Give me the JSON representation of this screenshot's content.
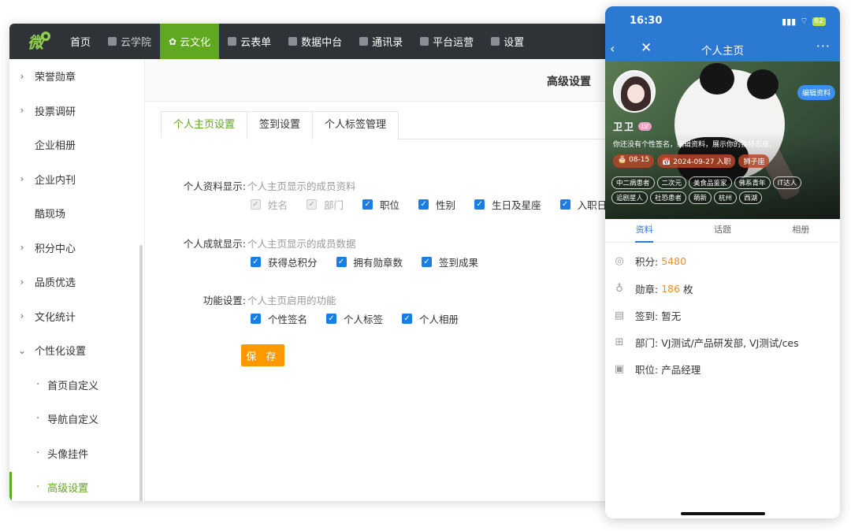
{
  "topnav": {
    "logo_text": "微",
    "items": [
      {
        "label": "首页",
        "icon": "none"
      },
      {
        "label": "云学院",
        "icon": "book-icon"
      },
      {
        "label": "云文化",
        "icon": "gear-flower-icon",
        "active": true
      },
      {
        "label": "云表单",
        "icon": "form-icon"
      },
      {
        "label": "数据中台",
        "icon": "cube-icon"
      },
      {
        "label": "通讯录",
        "icon": "contact-icon"
      },
      {
        "label": "平台运营",
        "icon": "grid-icon"
      },
      {
        "label": "设置",
        "icon": "grid-icon"
      }
    ],
    "active_color": "#5fa81f"
  },
  "sidebar": {
    "items": [
      {
        "label": "荣誉勋章",
        "arrow": "›"
      },
      {
        "label": "投票调研",
        "arrow": "›"
      },
      {
        "label": "企业相册",
        "arrow": ""
      },
      {
        "label": "企业内刊",
        "arrow": "›"
      },
      {
        "label": "酷现场",
        "arrow": ""
      },
      {
        "label": "积分中心",
        "arrow": "›"
      },
      {
        "label": "品质优选",
        "arrow": "›"
      },
      {
        "label": "文化统计",
        "arrow": "›"
      },
      {
        "label": "个性化设置",
        "arrow": "⌄"
      }
    ],
    "subitems": [
      {
        "label": "首页自定义",
        "bullet": "·"
      },
      {
        "label": "导航自定义",
        "bullet": "·"
      },
      {
        "label": "头像挂件",
        "bullet": "·"
      },
      {
        "label": "高级设置",
        "bullet": "·",
        "active": true
      }
    ]
  },
  "content": {
    "title": "高级设置",
    "tabs": [
      "个人主页设置",
      "签到设置",
      "个人标签管理"
    ],
    "profile_display": {
      "label": "个人资料显示:",
      "hint": "个人主页显示的成员资料",
      "options": [
        {
          "label": "姓名",
          "checked": true,
          "disabled": true
        },
        {
          "label": "部门",
          "checked": true,
          "disabled": true
        },
        {
          "label": "职位",
          "checked": true,
          "disabled": false
        },
        {
          "label": "性别",
          "checked": true,
          "disabled": false
        },
        {
          "label": "生日及星座",
          "checked": true,
          "disabled": false
        },
        {
          "label": "入职日期",
          "checked": true,
          "disabled": false
        }
      ]
    },
    "achievement_display": {
      "label": "个人成就显示:",
      "hint": "个人主页显示的成员数据",
      "options": [
        {
          "label": "获得总积分",
          "checked": true
        },
        {
          "label": "拥有勋章数",
          "checked": true
        },
        {
          "label": "签到成果",
          "checked": true
        }
      ]
    },
    "function_settings": {
      "label": "功能设置:",
      "hint": "个人主页启用的功能",
      "options": [
        {
          "label": "个性签名",
          "checked": true
        },
        {
          "label": "个人标签",
          "checked": true
        },
        {
          "label": "个人相册",
          "checked": true
        }
      ]
    },
    "save_label": "保 存",
    "check_mark": "✓"
  },
  "phone": {
    "status": {
      "time": "16:30",
      "signal": "📶",
      "wifi": "⌔",
      "battery": "62"
    },
    "nav": {
      "back": "‹",
      "close": "✕",
      "title": "个人主页",
      "more": "···"
    },
    "edit_label": "编辑资料",
    "user_name": "卫卫",
    "level_badge": "LV",
    "bio": "你还没有个性签名，编辑资料，展示你的独特态度。",
    "meta": [
      "🎂 08-15",
      "📅 2024-09-27 入职",
      "狮子座"
    ],
    "tags": [
      "中二病患者",
      "二次元",
      "美食品鉴家",
      "佛系青年",
      "IT达人",
      "追剧星人",
      "社恐患者",
      "萌新",
      "杭州",
      "西湖"
    ],
    "tabs": [
      "资料",
      "话题",
      "相册"
    ],
    "info": [
      {
        "icon": "points-icon",
        "glyph": "◎",
        "label": "积分:",
        "value": "5480",
        "suffix": ""
      },
      {
        "icon": "medal-icon",
        "glyph": "♁",
        "label": "勋章:",
        "value": "186",
        "suffix": " 枚"
      },
      {
        "icon": "calendar-icon",
        "glyph": "▤",
        "label": "签到:",
        "value": "暂无",
        "suffix": ""
      },
      {
        "icon": "org-icon",
        "glyph": "⊞",
        "label": "部门:",
        "value": "VJ测试/产品研发部, VJ测试/ces",
        "suffix": ""
      },
      {
        "icon": "id-card-icon",
        "glyph": "▣",
        "label": "职位:",
        "value": "产品经理",
        "suffix": ""
      }
    ],
    "accent": "#2c79d3"
  }
}
